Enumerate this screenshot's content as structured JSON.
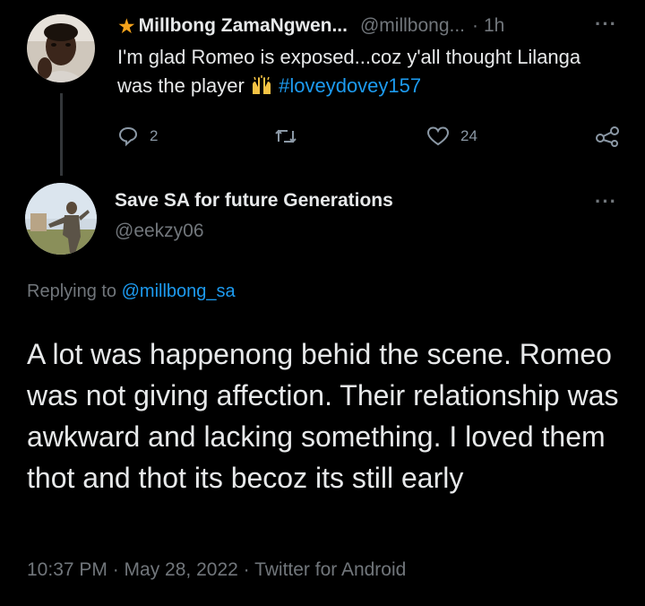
{
  "parent_tweet": {
    "author_name": "Millbong ZamaNgwen...",
    "handle": "@millbong...",
    "separator": "·",
    "time": "1h",
    "text": "I'm glad Romeo is exposed...coz y'all thought Lilanga was the player",
    "emoji": "raising-hands",
    "hashtag": "#loveydovey157",
    "replies": "2",
    "likes": "24",
    "star_color": "#f4a21b"
  },
  "reply_tweet": {
    "author_name": "Save SA for future Generations",
    "handle": "@eekzy06",
    "replying_prefix": "Replying to",
    "replying_to": "@millbong_sa",
    "text": "A lot was happenong behid the scene. Romeo was not giving affection. Their relationship was awkward and lacking something. I loved them thot and thot its becoz its still early",
    "timestamp": "10:37 PM · May 28, 2022 · Twitter for Android"
  },
  "colors": {
    "background": "#000000",
    "text": "#e7e9ea",
    "secondary": "#71767b",
    "link": "#1d9bf0"
  },
  "icons": [
    "star-icon",
    "more-icon",
    "reply-icon",
    "retweet-icon",
    "like-icon",
    "share-icon",
    "raising-hands-emoji"
  ]
}
